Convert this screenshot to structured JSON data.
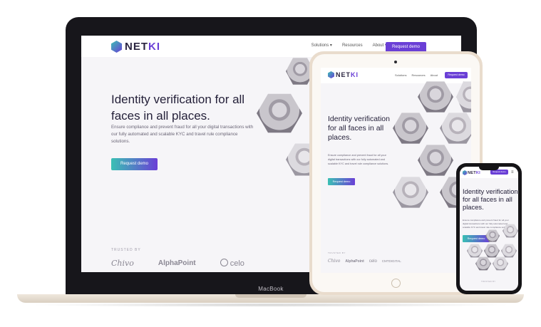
{
  "brand": {
    "name_main": "NET",
    "name_accent": "KI"
  },
  "nav": {
    "solutions": "Solutions",
    "resources": "Resources",
    "about": "About",
    "chevron": "▾",
    "cta": "Request demo"
  },
  "hero": {
    "title": "Identity verification for all faces in all places.",
    "subtitle": "Ensure compliance and prevent fraud for all your digital transactions with our fully automated and scalable KYC and travel rule compliance solutions.",
    "button": "Request demo"
  },
  "trusted": {
    "label": "TRUSTED BY",
    "brands": [
      "Chivo",
      "AlphaPoint",
      "celo"
    ],
    "tablet_brands": [
      "Chivo",
      "AlphaPoint",
      "celo",
      "CMTDIGITAL"
    ]
  },
  "device": {
    "laptop_label": "MacBook"
  },
  "colors": {
    "accent": "#6a3fd6",
    "teal": "#3ac0b4",
    "text": "#25213a"
  }
}
